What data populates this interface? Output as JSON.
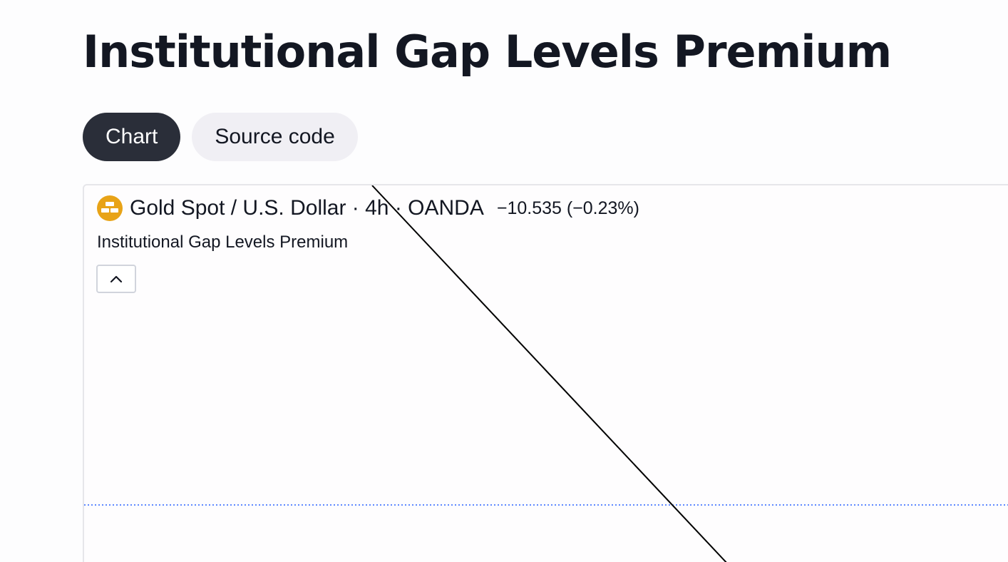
{
  "page": {
    "title": "Institutional Gap Levels Premium"
  },
  "tabs": [
    {
      "label": "Chart",
      "active": true
    },
    {
      "label": "Source code",
      "active": false
    }
  ],
  "chart": {
    "symbol_icon": "gold-bars-icon",
    "symbol_label": "Gold Spot / U.S. Dollar · 4h · OANDA",
    "change": "−10.535 (−0.23%)",
    "study_name": "Institutional Gap Levels Premium",
    "collapse_icon": "chevron-up-icon",
    "colors": {
      "logo": "#e8a317",
      "level_line": "#2962ff",
      "drawing_line": "#000000"
    }
  }
}
